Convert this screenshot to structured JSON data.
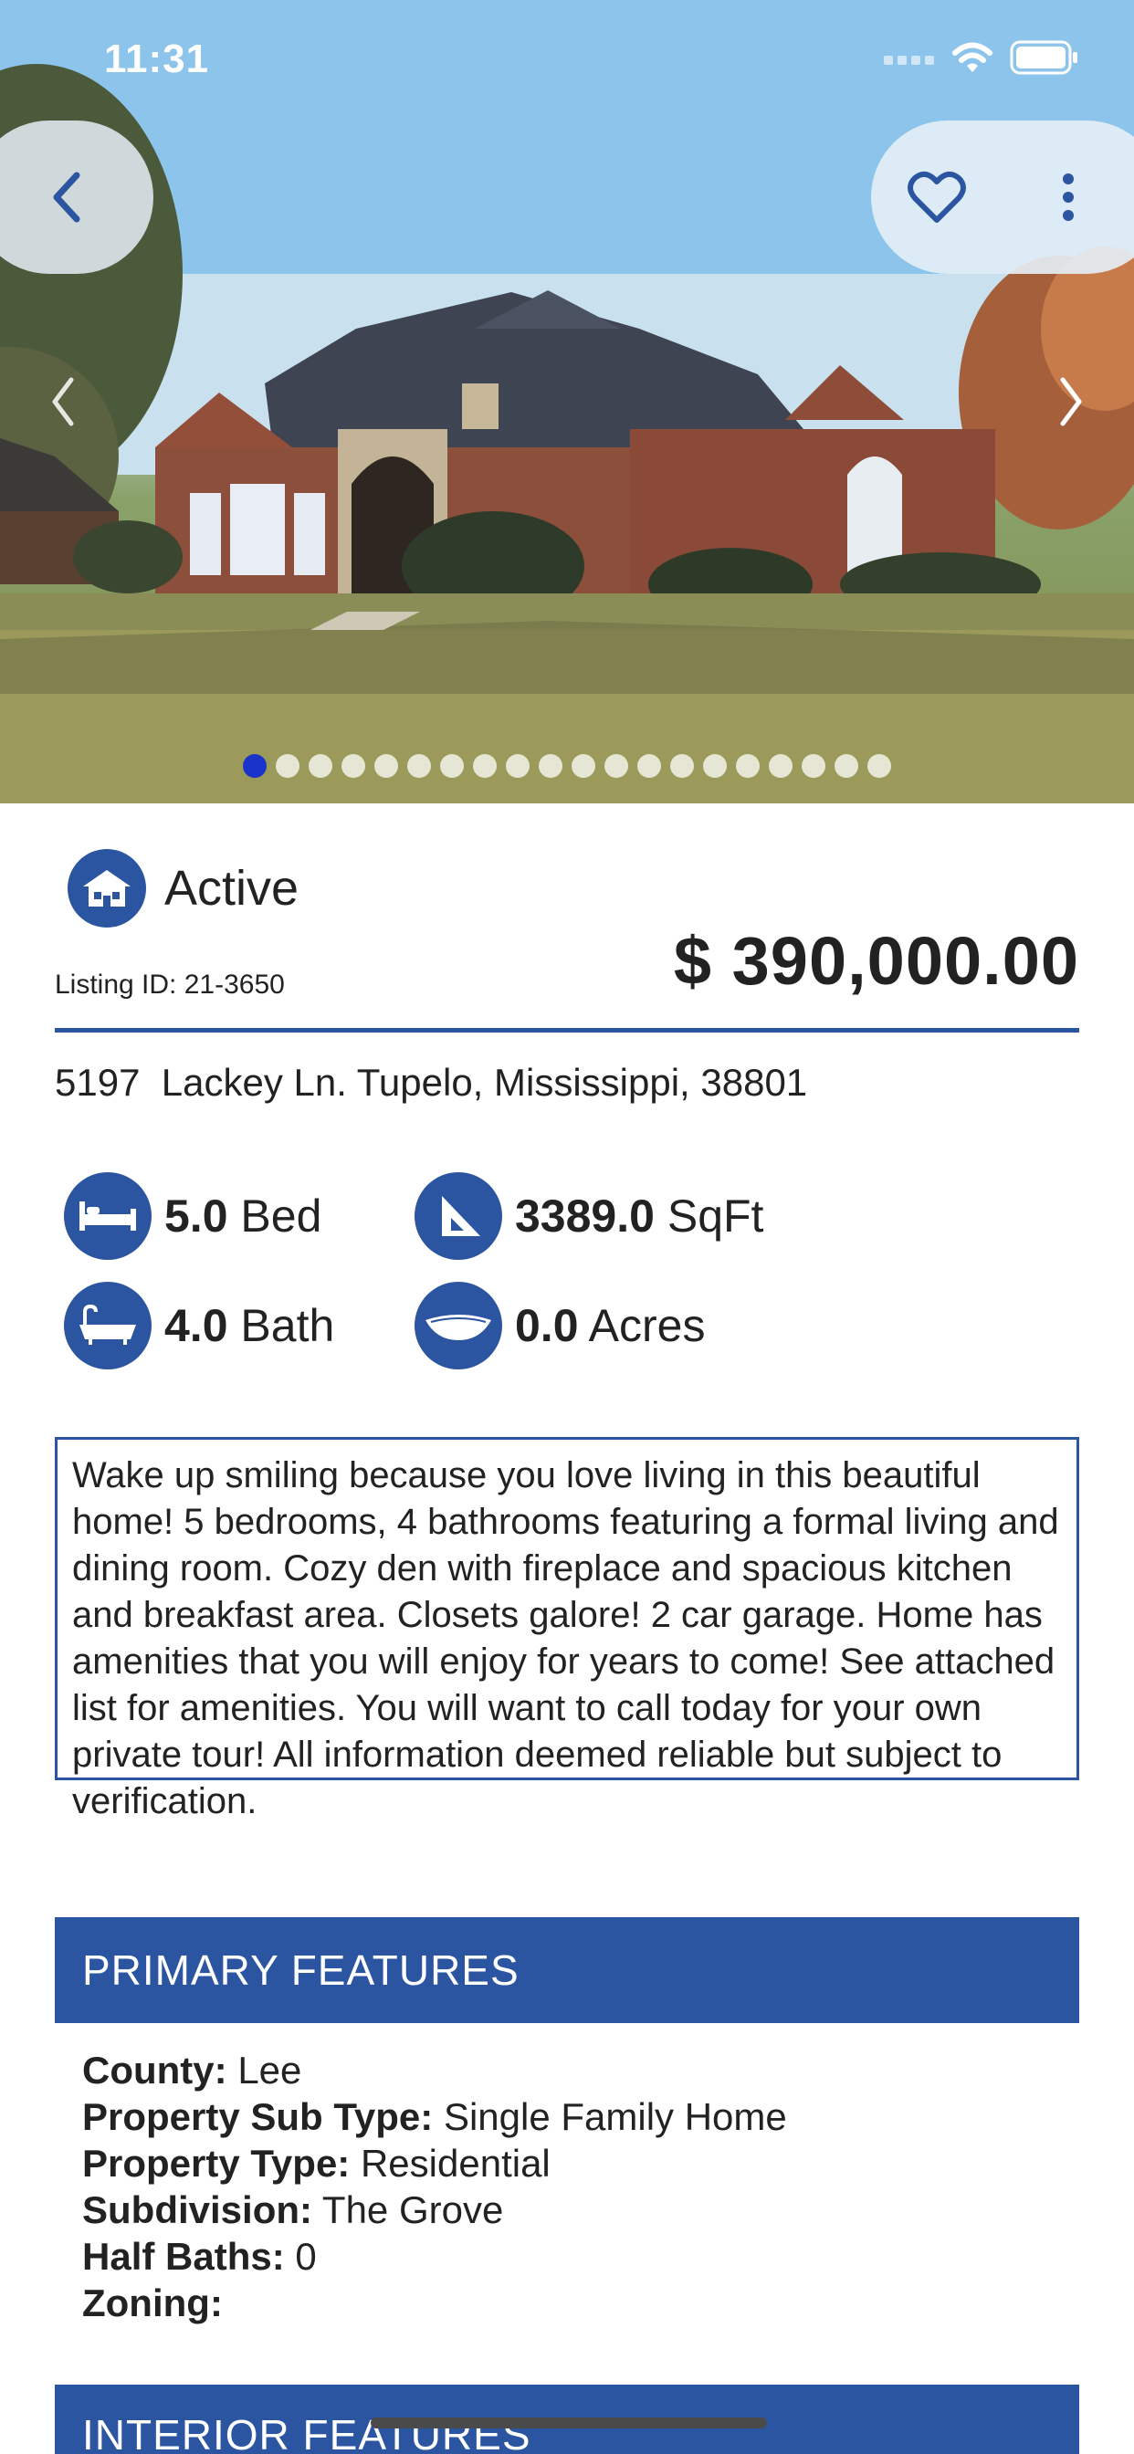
{
  "status_bar": {
    "time": "11:31"
  },
  "carousel": {
    "total_dots": 20,
    "active_index": 0
  },
  "listing": {
    "status": "Active",
    "listing_id": "Listing ID: 21-3650",
    "price": "$ 390,000.00",
    "address": "5197  Lackey Ln. Tupelo, Mississippi, 38801"
  },
  "stats": {
    "bed_value": "5.0",
    "bed_label": "Bed",
    "sqft_value": "3389.0",
    "sqft_label": "SqFt",
    "bath_value": "4.0",
    "bath_label": "Bath",
    "acres_value": "0.0",
    "acres_label": "Acres"
  },
  "description": "Wake up smiling because you love living in this beautiful home! 5 bedrooms, 4 bathrooms featuring a formal living and dining room. Cozy den with fireplace and spacious kitchen and breakfast area. Closets galore! 2 car garage. Home has amenities that you will enjoy for years to come! See attached list for amenities. You will want to call today for your own private tour! All information deemed reliable but subject to verification.",
  "primary_features": {
    "title": "PRIMARY FEATURES",
    "rows": [
      {
        "label": "County:",
        "value": "Lee"
      },
      {
        "label": "Property Sub Type:",
        "value": "Single Family Home"
      },
      {
        "label": "Property Type:",
        "value": "Residential"
      },
      {
        "label": "Subdivision:",
        "value": "The Grove"
      },
      {
        "label": "Half Baths:",
        "value": "0"
      },
      {
        "label": "Zoning:",
        "value": ""
      }
    ]
  },
  "interior_features": {
    "title": "INTERIOR FEATURES"
  },
  "colors": {
    "accent": "#2b55a1",
    "active_dot": "#1a33c8"
  },
  "icons": {
    "back": "chevron-left-icon",
    "favorite": "heart-icon",
    "more": "more-vertical-icon",
    "status": "house-icon",
    "bed": "bed-icon",
    "sqft": "set-square-icon",
    "bath": "bathtub-icon",
    "acres": "land-icon"
  }
}
